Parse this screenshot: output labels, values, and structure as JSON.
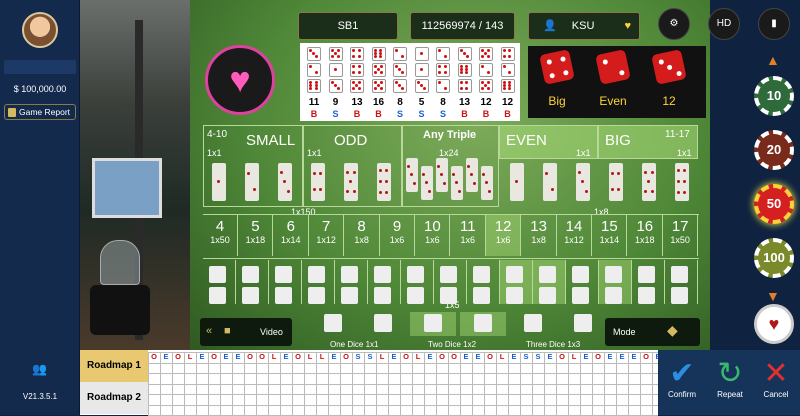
{
  "sidebar": {
    "balance": "$ 100,000.00",
    "game_report": "Game Report",
    "version": "V21.3.5.1"
  },
  "header": {
    "table_id": "SB1",
    "round_id": "112569974 / 143",
    "player": "KSU"
  },
  "last_result": {
    "dice": [
      4,
      2,
      3
    ],
    "labels": [
      "Big",
      "Even",
      "12"
    ]
  },
  "history": [
    {
      "sum": "11",
      "tag": "B",
      "color": "#d01010"
    },
    {
      "sum": "9",
      "tag": "S",
      "color": "#1a60d0"
    },
    {
      "sum": "13",
      "tag": "B",
      "color": "#d01010"
    },
    {
      "sum": "16",
      "tag": "B",
      "color": "#d01010"
    },
    {
      "sum": "8",
      "tag": "S",
      "color": "#1a60d0"
    },
    {
      "sum": "5",
      "tag": "S",
      "color": "#1a60d0"
    },
    {
      "sum": "8",
      "tag": "S",
      "color": "#1a60d0"
    },
    {
      "sum": "13",
      "tag": "B",
      "color": "#d01010"
    },
    {
      "sum": "12",
      "tag": "B",
      "color": "#d01010"
    },
    {
      "sum": "12",
      "tag": "B",
      "color": "#d01010"
    }
  ],
  "board": {
    "small_range": "4-10",
    "small": "SMALL",
    "small_odds": "1x1",
    "odd": "ODD",
    "odd_odds": "1x1",
    "triple": "Any Triple",
    "triple_odds": "1x24",
    "even": "EVEN",
    "even_odds": "1x1",
    "big": "BIG",
    "big_range": "11-17",
    "big_odds": "1x1",
    "specific_triple_odds": "1x150",
    "double_odds": "1x8",
    "combo_odds": "1x5",
    "sums": [
      {
        "n": "4",
        "o": "1x50"
      },
      {
        "n": "5",
        "o": "1x18"
      },
      {
        "n": "6",
        "o": "1x14"
      },
      {
        "n": "7",
        "o": "1x12"
      },
      {
        "n": "8",
        "o": "1x8"
      },
      {
        "n": "9",
        "o": "1x6"
      },
      {
        "n": "10",
        "o": "1x6"
      },
      {
        "n": "11",
        "o": "1x6"
      },
      {
        "n": "12",
        "o": "1x6"
      },
      {
        "n": "13",
        "o": "1x8"
      },
      {
        "n": "14",
        "o": "1x12"
      },
      {
        "n": "15",
        "o": "1x14"
      },
      {
        "n": "16",
        "o": "1x18"
      },
      {
        "n": "17",
        "o": "1x50"
      }
    ],
    "video_label": "Video",
    "mode_label": "Mode",
    "single_labels": [
      "One Dice 1x1",
      "Two Dice 1x2",
      "Three Dice 1x3"
    ]
  },
  "chips": [
    "10",
    "20",
    "50",
    "100"
  ],
  "roadmap": {
    "tab1": "Roadmap 1",
    "tab2": "Roadmap 2",
    "row1": "OEOLEOEEOOLEOLLEOSSLEOLEOOEEOLESSEOLEOEEEOE"
  },
  "actions": {
    "confirm": "Confirm",
    "repeat": "Repeat",
    "cancel": "Cancel"
  },
  "colors": {
    "accent": "#d6b860",
    "red": "#d41c1c",
    "blue": "#1a60d0"
  }
}
